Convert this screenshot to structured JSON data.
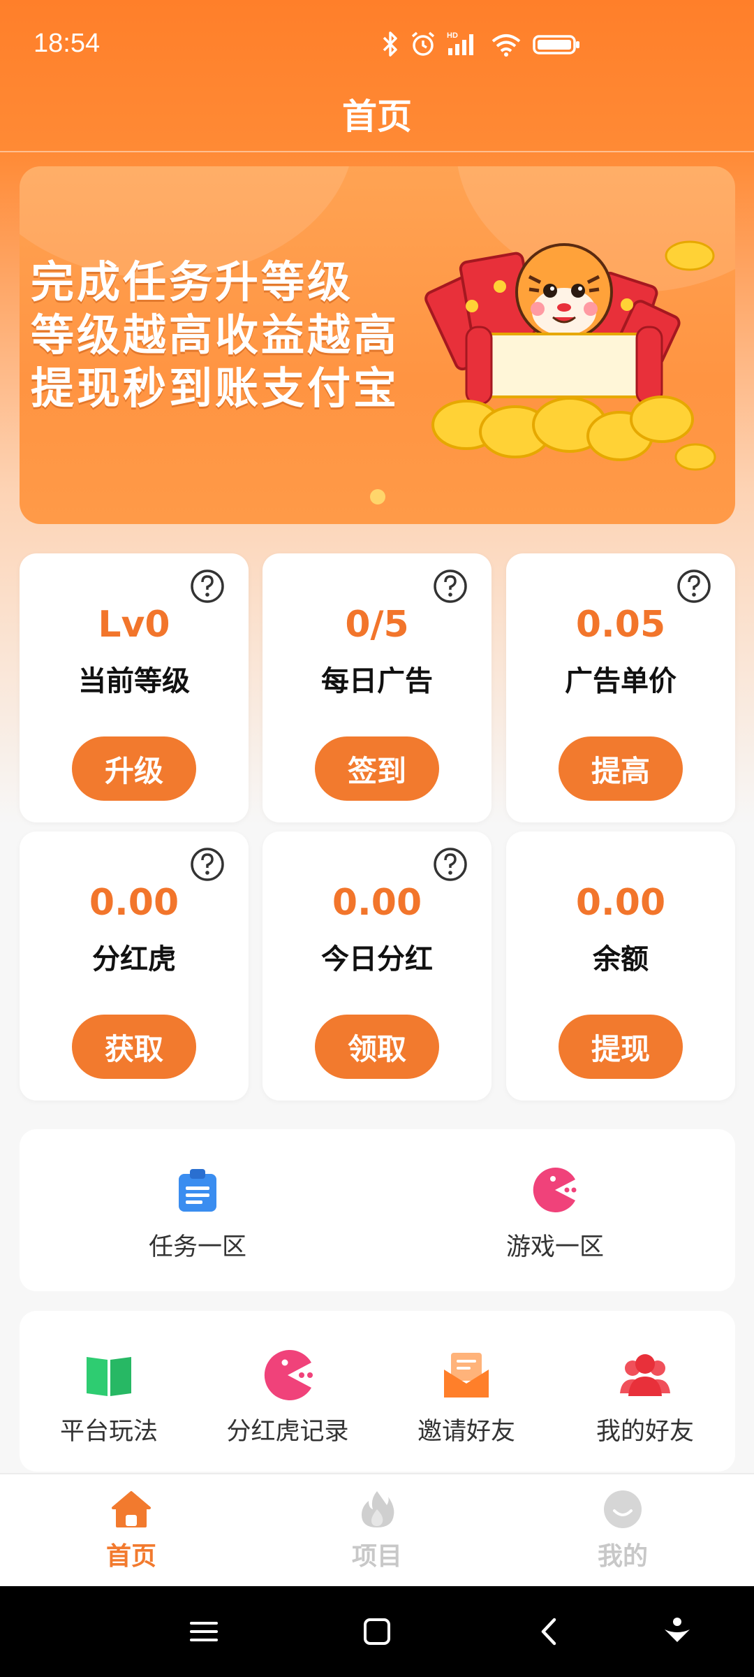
{
  "status": {
    "time": "18:54"
  },
  "header": {
    "title": "首页"
  },
  "banner": {
    "lines": [
      "完成任务升等级",
      "等级越高收益越高",
      "提现秒到账支付宝"
    ]
  },
  "stats": [
    {
      "value": "Lv0",
      "label": "当前等级",
      "button": "升级",
      "help": true
    },
    {
      "value": "0/5",
      "label": "每日广告",
      "button": "签到",
      "help": true
    },
    {
      "value": "0.05",
      "label": "广告单价",
      "button": "提高",
      "help": true
    },
    {
      "value": "0.00",
      "label": "分红虎",
      "button": "获取",
      "help": true
    },
    {
      "value": "0.00",
      "label": "今日分红",
      "button": "领取",
      "help": true
    },
    {
      "value": "0.00",
      "label": "余额",
      "button": "提现",
      "help": false
    }
  ],
  "zones": [
    {
      "label": "任务一区",
      "icon": "clipboard-icon"
    },
    {
      "label": "游戏一区",
      "icon": "game-pacman-icon"
    }
  ],
  "quick": [
    {
      "label": "平台玩法",
      "icon": "book-icon"
    },
    {
      "label": "分红虎记录",
      "icon": "pacman-icon"
    },
    {
      "label": "邀请好友",
      "icon": "envelope-icon"
    },
    {
      "label": "我的好友",
      "icon": "friends-icon"
    }
  ],
  "tabs": [
    {
      "label": "首页",
      "icon": "home-icon",
      "active": true
    },
    {
      "label": "项目",
      "icon": "flame-icon",
      "active": false
    },
    {
      "label": "我的",
      "icon": "smile-icon",
      "active": false
    }
  ],
  "colors": {
    "primary": "#f27a2e",
    "header": "#ff7f2a"
  }
}
